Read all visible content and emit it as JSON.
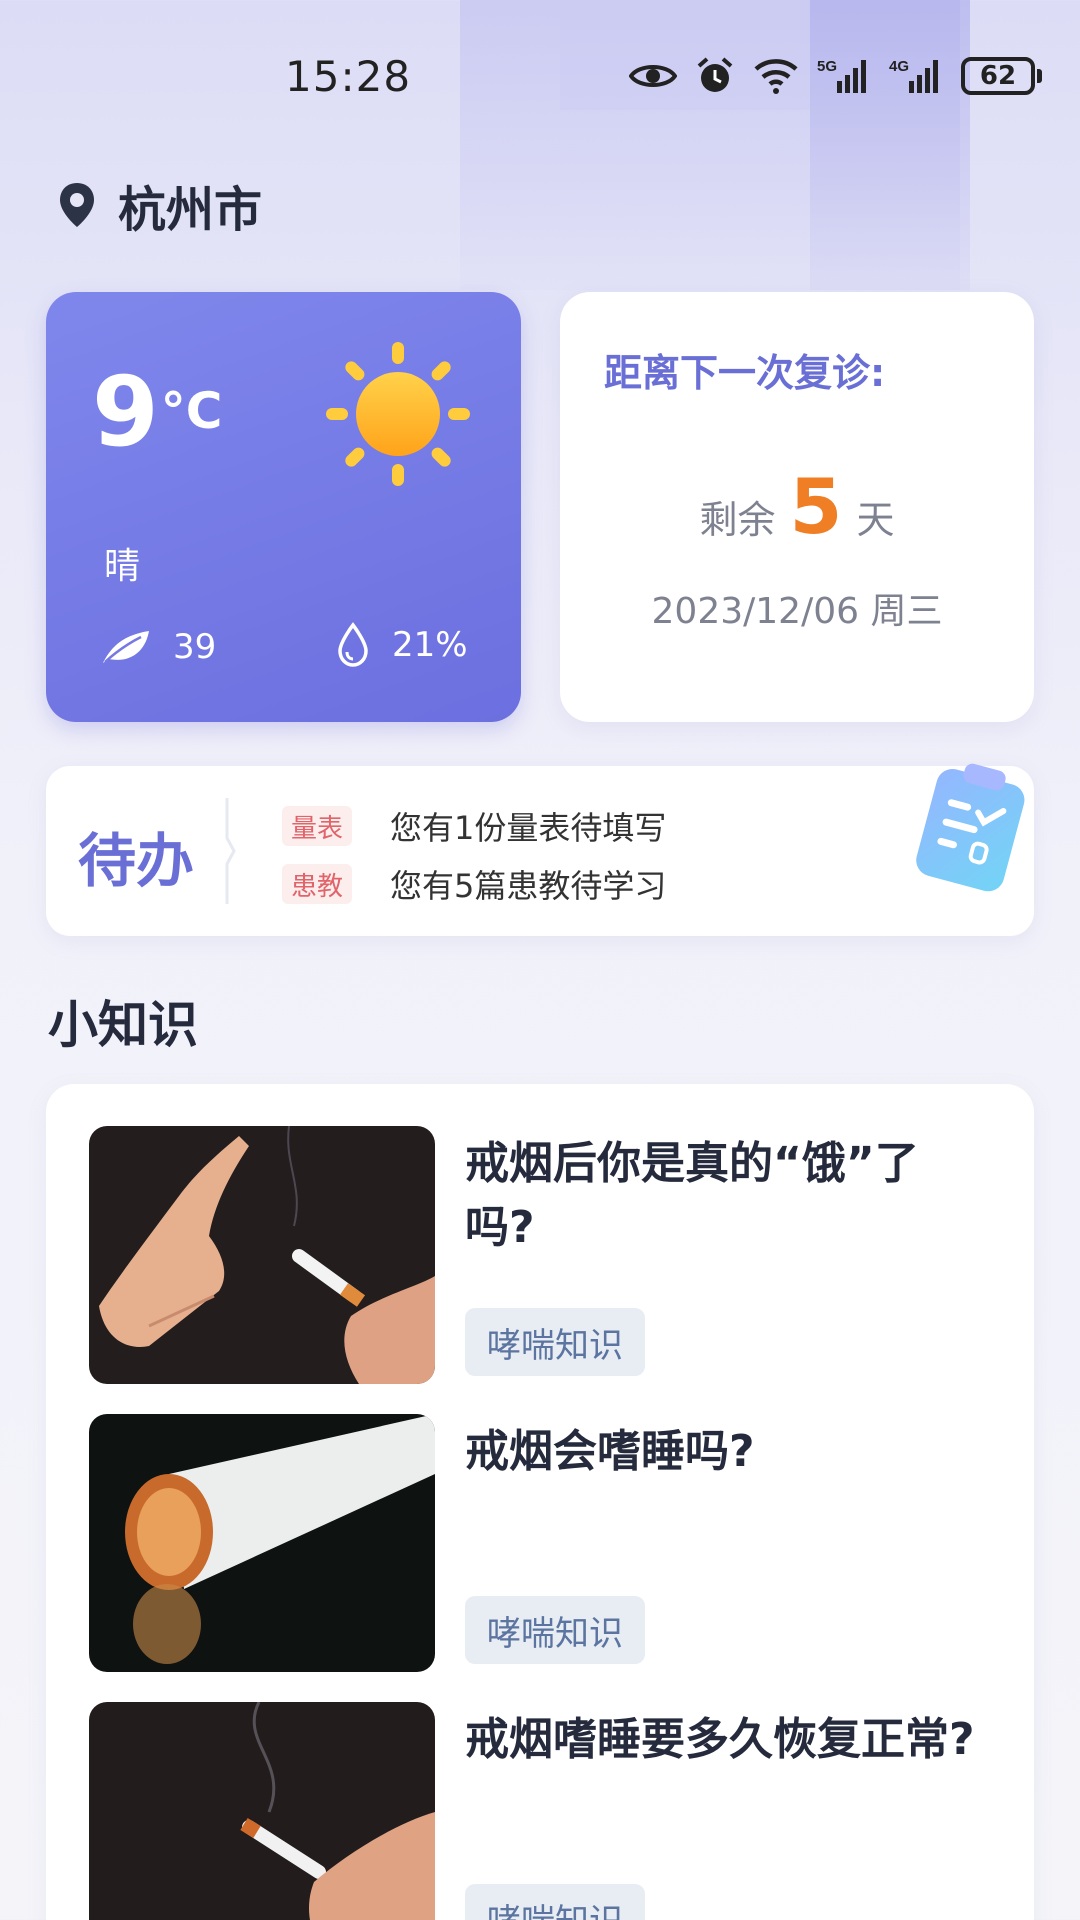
{
  "status_bar": {
    "time": "15:28",
    "network_5g": "5G",
    "network_4g": "4G",
    "battery": "62"
  },
  "location": {
    "city": "杭州市",
    "icon": "location-pin-icon"
  },
  "weather": {
    "temperature": "9",
    "unit": "°C",
    "condition": "晴",
    "aqi": "39",
    "humidity": "21%",
    "icon": "sun-icon"
  },
  "revisit": {
    "title": "距离下一次复诊:",
    "remain_prefix": "剩余",
    "remain_days": "5",
    "remain_suffix": "天",
    "date": "2023/12/06 周三"
  },
  "todo": {
    "title": "待办",
    "items": [
      {
        "tag": "量表",
        "text": "您有1份量表待填写"
      },
      {
        "tag": "患教",
        "text": "您有5篇患教待学习"
      }
    ]
  },
  "knowledge": {
    "section_title": "小知识",
    "articles": [
      {
        "title": "戒烟后你是真的“饿”了吗?",
        "tag": "哮喘知识"
      },
      {
        "title": "戒烟会嗜睡吗?",
        "tag": "哮喘知识"
      },
      {
        "title": "戒烟嗜睡要多久恢复正常?",
        "tag": "哮喘知识"
      }
    ]
  },
  "colors": {
    "accent": "#6a6fd6",
    "highlight": "#f07e24",
    "tag_red": "#e0646a",
    "tag_blue": "#5b74a0"
  }
}
